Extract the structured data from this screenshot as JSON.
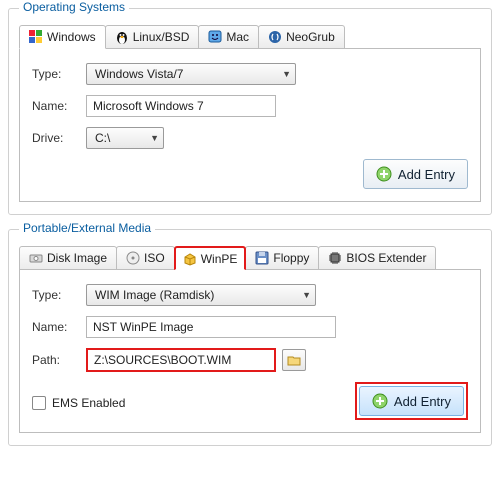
{
  "group1": {
    "title": "Operating Systems",
    "tabs": [
      {
        "label": "Windows",
        "icon": "windows-flag"
      },
      {
        "label": "Linux/BSD",
        "icon": "penguin"
      },
      {
        "label": "Mac",
        "icon": "mac-smiley"
      },
      {
        "label": "NeoGrub",
        "icon": "neogrub"
      }
    ],
    "fields": {
      "type_label": "Type:",
      "type_value": "Windows Vista/7",
      "name_label": "Name:",
      "name_value": "Microsoft Windows 7",
      "drive_label": "Drive:",
      "drive_value": "C:\\"
    },
    "add_button": "Add Entry"
  },
  "group2": {
    "title": "Portable/External Media",
    "tabs": [
      {
        "label": "Disk Image",
        "icon": "disk"
      },
      {
        "label": "ISO",
        "icon": "iso"
      },
      {
        "label": "WinPE",
        "icon": "box"
      },
      {
        "label": "Floppy",
        "icon": "floppy"
      },
      {
        "label": "BIOS Extender",
        "icon": "chip"
      }
    ],
    "fields": {
      "type_label": "Type:",
      "type_value": "WIM Image (Ramdisk)",
      "name_label": "Name:",
      "name_value": "NST WinPE Image",
      "path_label": "Path:",
      "path_value": "Z:\\SOURCES\\BOOT.WIM",
      "ems_label": "EMS Enabled"
    },
    "add_button": "Add Entry"
  }
}
